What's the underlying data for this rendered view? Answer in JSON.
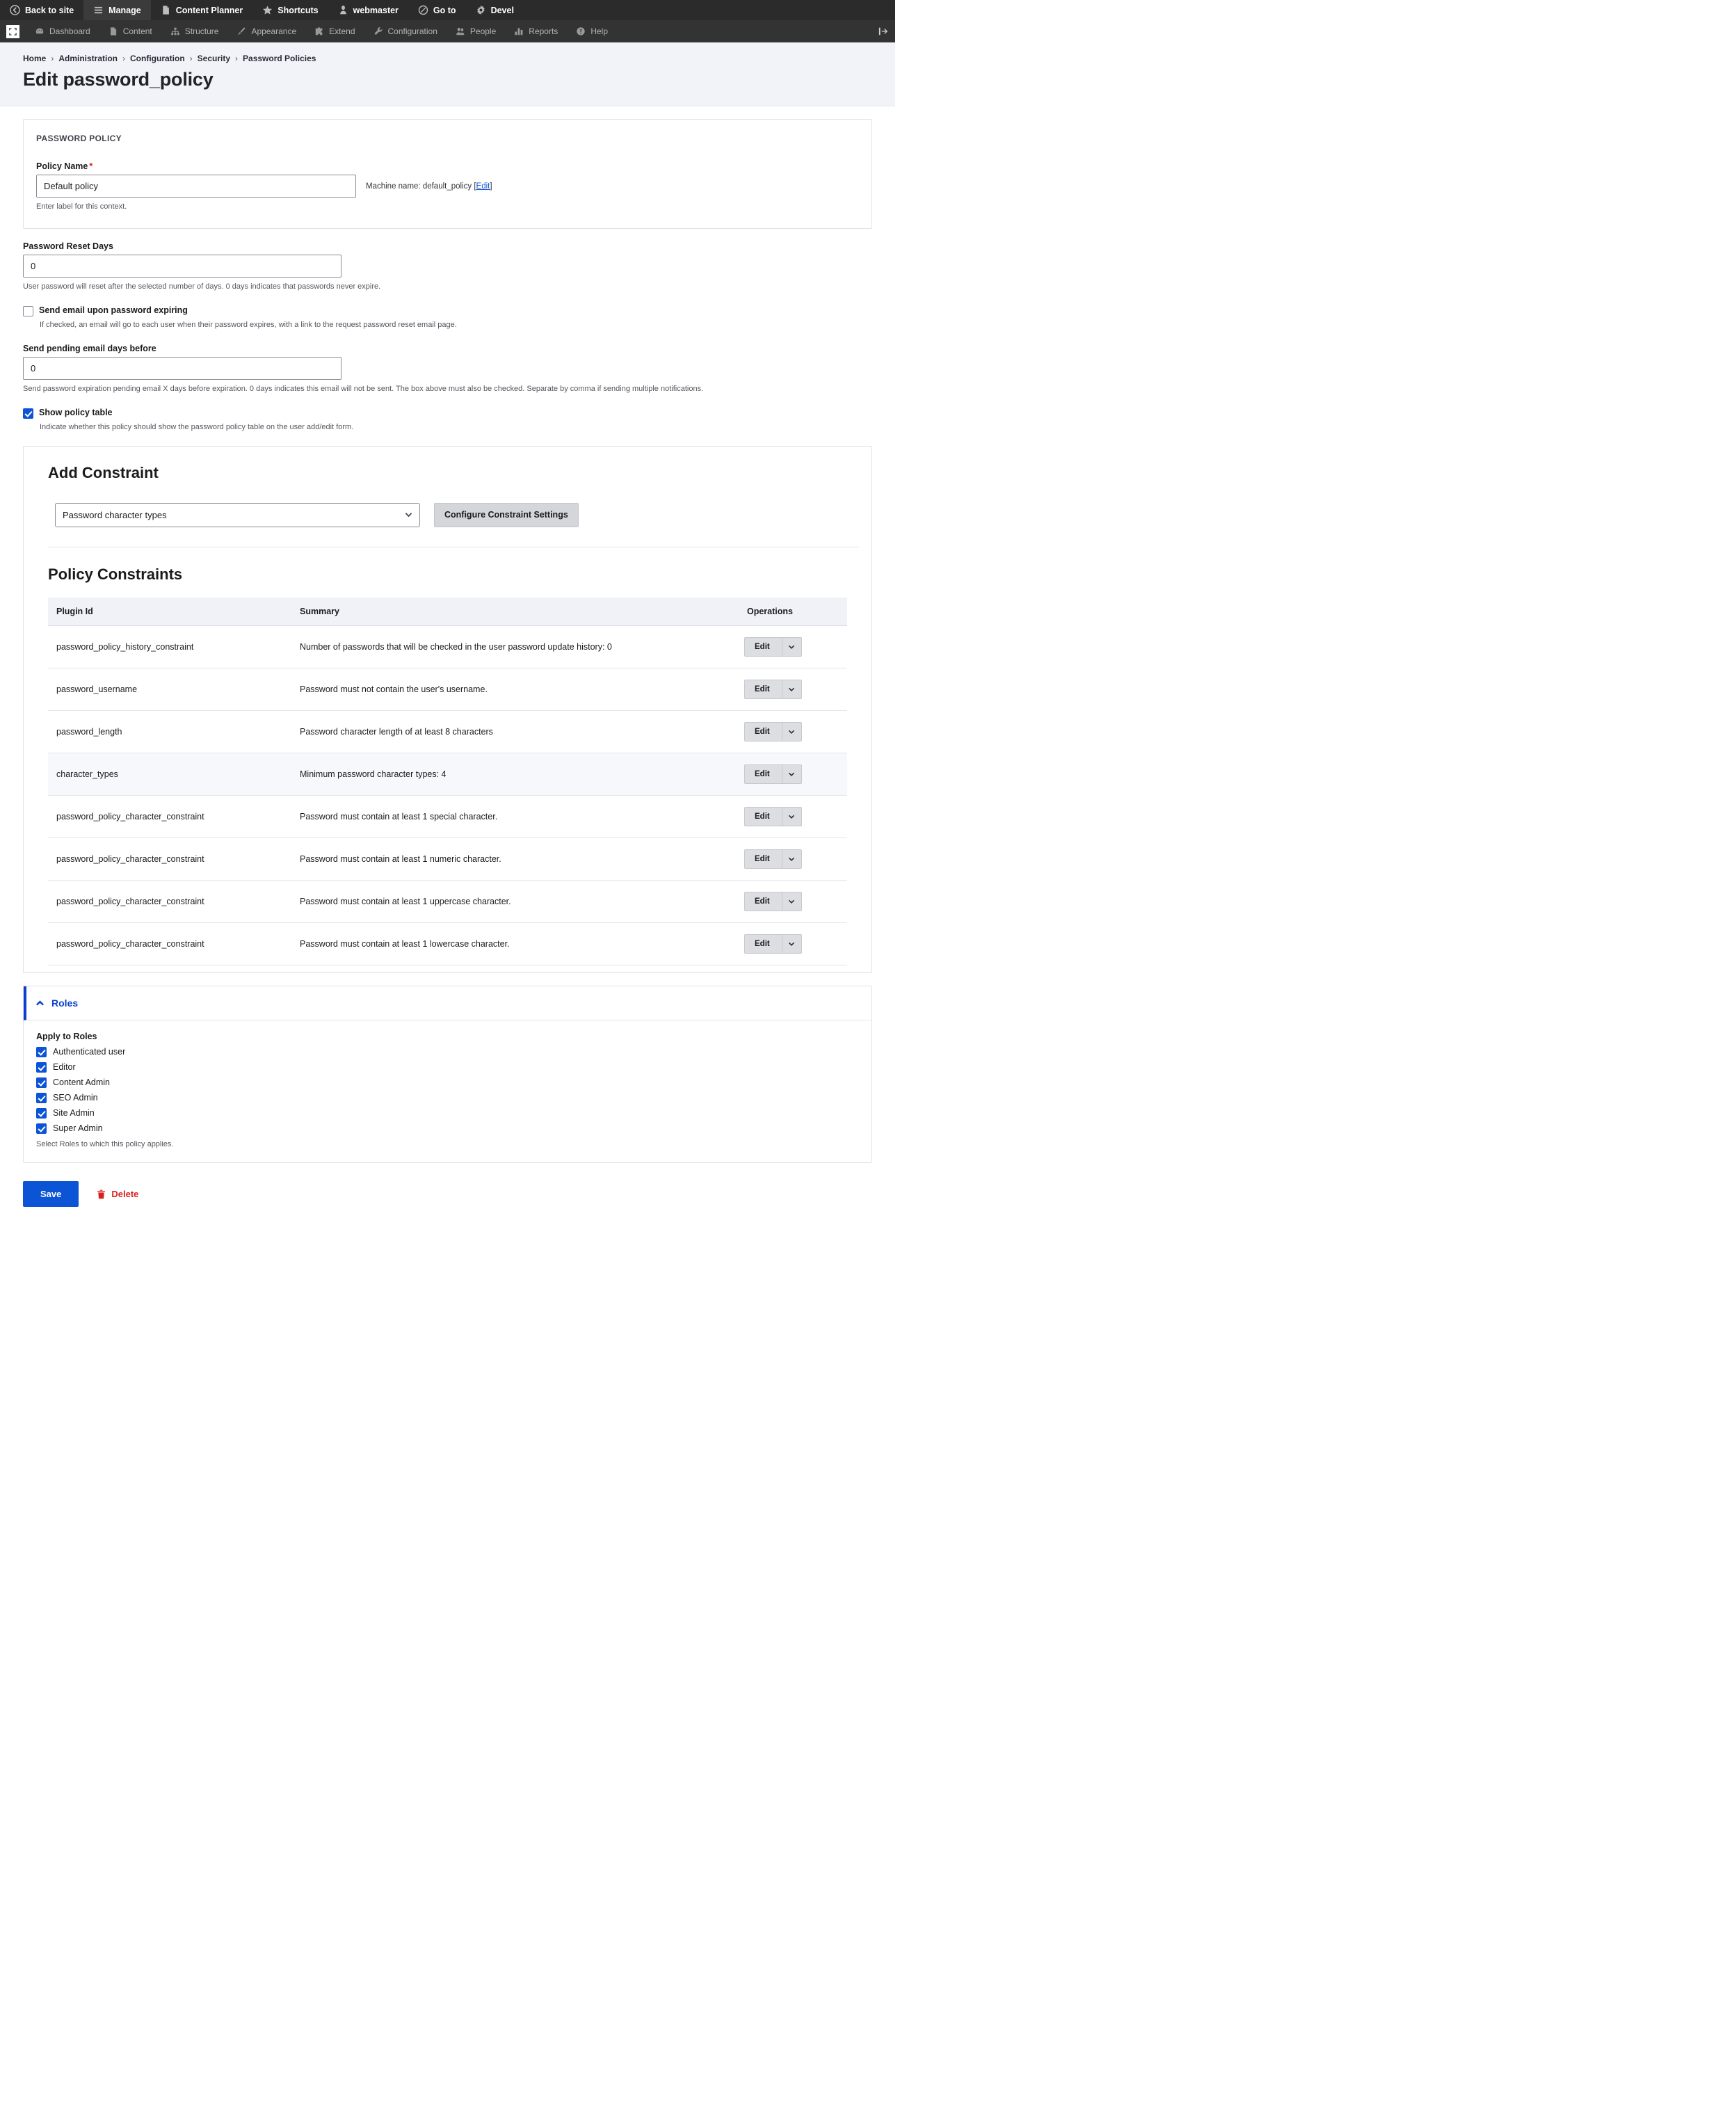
{
  "toolbar": {
    "top_items": [
      {
        "label": "Back to site",
        "icon": "back-arrow-icon",
        "active": false
      },
      {
        "label": "Manage",
        "icon": "hamburger-icon",
        "active": true
      },
      {
        "label": "Content Planner",
        "icon": "document-icon",
        "active": false
      },
      {
        "label": "Shortcuts",
        "icon": "star-icon",
        "active": false
      },
      {
        "label": "webmaster",
        "icon": "user-icon",
        "active": false
      },
      {
        "label": "Go to",
        "icon": "compass-icon",
        "active": false
      },
      {
        "label": "Devel",
        "icon": "gear-icon",
        "active": false
      }
    ],
    "second_items": [
      {
        "label": "Dashboard",
        "icon": "gauge-icon"
      },
      {
        "label": "Content",
        "icon": "document-icon"
      },
      {
        "label": "Structure",
        "icon": "hierarchy-icon"
      },
      {
        "label": "Appearance",
        "icon": "brush-icon"
      },
      {
        "label": "Extend",
        "icon": "puzzle-icon"
      },
      {
        "label": "Configuration",
        "icon": "wrench-icon"
      },
      {
        "label": "People",
        "icon": "people-icon"
      },
      {
        "label": "Reports",
        "icon": "bar-chart-icon"
      },
      {
        "label": "Help",
        "icon": "question-mark-icon"
      }
    ],
    "orientation_icon": "orientation-toggle-icon",
    "tray_icon": "vertical-orientation-icon"
  },
  "breadcrumb": {
    "items": [
      "Home",
      "Administration",
      "Configuration",
      "Security",
      "Password Policies"
    ],
    "separator": "›"
  },
  "page_title": "Edit password_policy",
  "password_policy_card": {
    "section_label": "PASSWORD POLICY",
    "policy_name_label": "Policy Name",
    "required_marker": "*",
    "policy_name_value": "Default policy",
    "policy_name_description": "Enter label for this context.",
    "machine_name_prefix": "Machine name: default_policy [",
    "machine_name_edit": "Edit",
    "machine_name_suffix": "]"
  },
  "reset_days": {
    "label": "Password Reset Days",
    "value": "0",
    "description": "User password will reset after the selected number of days. 0 days indicates that passwords never expire."
  },
  "send_email": {
    "label": "Send email upon password expiring",
    "checked": false,
    "description": "If checked, an email will go to each user when their password expires, with a link to the request password reset email page."
  },
  "pending_email_days": {
    "label": "Send pending email days before",
    "value": "0",
    "description": "Send password expiration pending email X days before expiration. 0 days indicates this email will not be sent. The box above must also be checked. Separate by comma if sending multiple notifications."
  },
  "show_policy_table": {
    "label": "Show policy table",
    "checked": true,
    "description": "Indicate whether this policy should show the password policy table on the user add/edit form."
  },
  "add_constraint": {
    "heading": "Add Constraint",
    "selected_option": "Password character types",
    "options": [
      "Password character types"
    ],
    "configure_button": "Configure Constraint Settings"
  },
  "policy_constraints": {
    "heading": "Policy Constraints",
    "columns": [
      "Plugin Id",
      "Summary",
      "Operations"
    ],
    "edit_label": "Edit",
    "rows": [
      {
        "plugin_id": "password_policy_history_constraint",
        "summary": "Number of passwords that will be checked in the user password update history: 0"
      },
      {
        "plugin_id": "password_username",
        "summary": "Password must not contain the user's username."
      },
      {
        "plugin_id": "password_length",
        "summary": "Password character length of at least 8 characters"
      },
      {
        "plugin_id": "character_types",
        "summary": "Minimum password character types: 4",
        "highlighted": true
      },
      {
        "plugin_id": "password_policy_character_constraint",
        "summary": "Password must contain at least 1 special character."
      },
      {
        "plugin_id": "password_policy_character_constraint",
        "summary": "Password must contain at least 1 numeric character."
      },
      {
        "plugin_id": "password_policy_character_constraint",
        "summary": "Password must contain at least 1 uppercase character."
      },
      {
        "plugin_id": "password_policy_character_constraint",
        "summary": "Password must contain at least 1 lowercase character."
      }
    ]
  },
  "roles": {
    "title": "Roles",
    "apply_label": "Apply to Roles",
    "items": [
      {
        "label": "Authenticated user",
        "checked": true
      },
      {
        "label": "Editor",
        "checked": true
      },
      {
        "label": "Content Admin",
        "checked": true
      },
      {
        "label": "SEO Admin",
        "checked": true
      },
      {
        "label": "Site Admin",
        "checked": true
      },
      {
        "label": "Super Admin",
        "checked": true
      }
    ],
    "description": "Select Roles to which this policy applies."
  },
  "actions": {
    "save_label": "Save",
    "delete_label": "Delete",
    "delete_icon": "trash-icon"
  },
  "colors": {
    "accent": "#0b54d6",
    "danger": "#d91f1f",
    "toolbar_dark": "#2b2b2b",
    "toolbar_second": "#333333",
    "page_head_bg": "#f2f3f8"
  }
}
